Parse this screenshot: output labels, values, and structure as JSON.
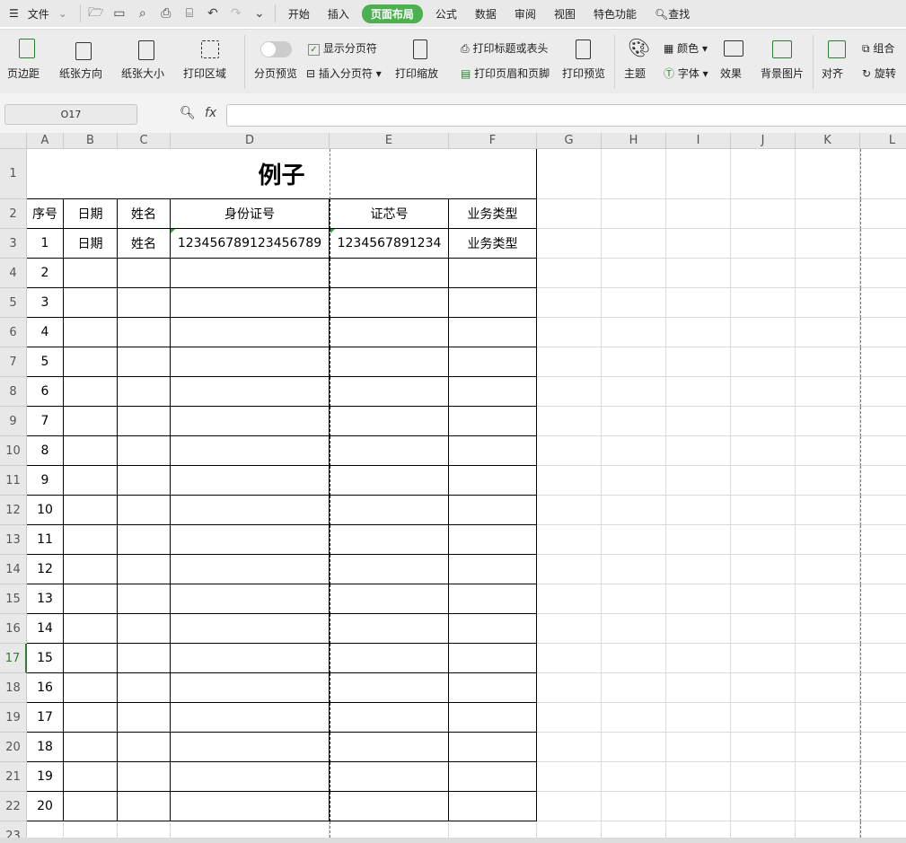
{
  "menubar": {
    "file": "文件",
    "tabs": [
      "开始",
      "插入",
      "页面布局",
      "公式",
      "数据",
      "审阅",
      "视图",
      "特色功能"
    ],
    "active_tab": "页面布局",
    "search": "查找"
  },
  "ribbon": {
    "margins": "页边距",
    "orientation": "纸张方向",
    "size": "纸张大小",
    "print_area": "打印区域",
    "page_break_preview": "分页预览",
    "show_page_break": "显示分页符",
    "show_page_break_checked": true,
    "insert_page_break": "插入分页符",
    "print_scale": "打印缩放",
    "print_titles": "打印标题或表头",
    "print_header_footer": "打印页眉和页脚",
    "print_preview": "打印预览",
    "theme": "主题",
    "colors": "颜色",
    "fonts": "字体",
    "effects": "效果",
    "background": "背景图片",
    "align": "对齐",
    "group": "组合",
    "rotate": "旋转"
  },
  "formula_bar": {
    "name_box": "O17",
    "fx": "fx",
    "value": ""
  },
  "sheet": {
    "columns": [
      "A",
      "B",
      "C",
      "D",
      "E",
      "F",
      "G",
      "H",
      "I",
      "J",
      "K",
      "L"
    ],
    "active_row": 17,
    "title": "例子",
    "headers": [
      "序号",
      "日期",
      "姓名",
      "身份证号",
      "证芯号",
      "业务类型"
    ],
    "rows": [
      [
        "1",
        "日期",
        "姓名",
        "123456789123456789",
        "1234567891234",
        "业务类型"
      ],
      [
        "2"
      ],
      [
        "3"
      ],
      [
        "4"
      ],
      [
        "5"
      ],
      [
        "6"
      ],
      [
        "7"
      ],
      [
        "8"
      ],
      [
        "9"
      ],
      [
        "10"
      ],
      [
        "11"
      ],
      [
        "12"
      ],
      [
        "13"
      ],
      [
        "14"
      ],
      [
        "15"
      ],
      [
        "16"
      ],
      [
        "17"
      ],
      [
        "18"
      ],
      [
        "19"
      ],
      [
        "20"
      ]
    ],
    "row_numbers": [
      "1",
      "2",
      "3",
      "4",
      "5",
      "6",
      "7",
      "8",
      "9",
      "10",
      "11",
      "12",
      "13",
      "14",
      "15",
      "16",
      "17",
      "18",
      "19",
      "20",
      "21",
      "22",
      "23"
    ]
  }
}
